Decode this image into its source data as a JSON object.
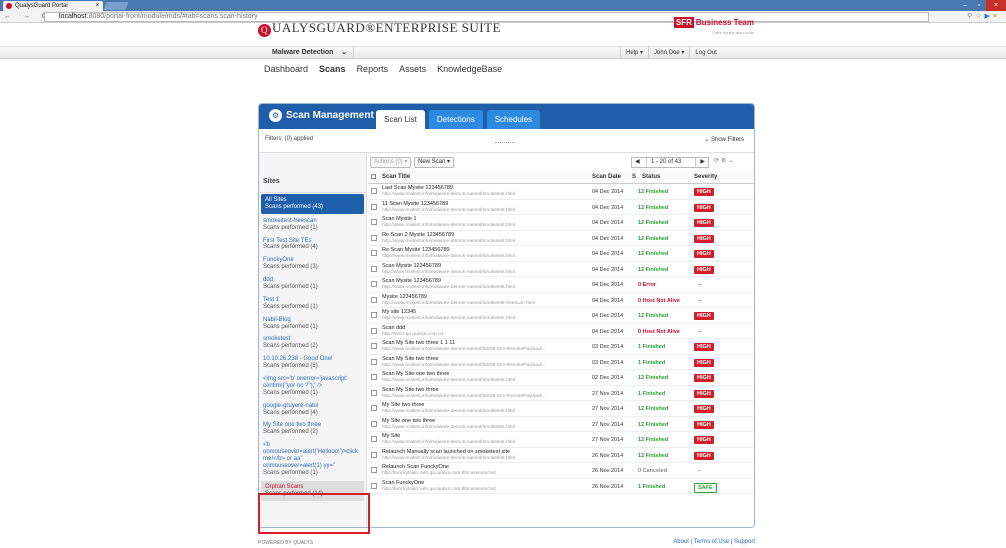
{
  "browser": {
    "tab_title": "QualysGuard Portal",
    "tab_close": "×",
    "url_host": "localhost",
    "url_rest": ":8080/portal-front/module/mds/#tab=scans.scan-history",
    "nav": "← → C"
  },
  "brand": {
    "logo_q": "Q",
    "logo_rest": "UALYSGUARD®ENTERPRISE SUITE",
    "partner_badge": "SFR",
    "partner_name": "Business Team",
    "partner_sub": "Faire équipe avec vous"
  },
  "menubar": {
    "module": "Malware Detection",
    "help": "Help ▾",
    "user": "John Doe ▾",
    "logout": "Log Out"
  },
  "topnav": [
    "Dashboard",
    "Scans",
    "Reports",
    "Assets",
    "KnowledgeBase"
  ],
  "panel": {
    "title": "Scan Management",
    "tabs": [
      "Scan List",
      "Detections",
      "Schedules"
    ],
    "filters_label": "Filters: (0) applied",
    "show_filters": "Show Filters"
  },
  "sidebar": {
    "title": "Sites",
    "sites": [
      {
        "name": "All Sites",
        "count": "Scans performed (43)",
        "state": "selected"
      },
      {
        "name": "smokeitest-freescan",
        "count": "Scans performed (1)"
      },
      {
        "name": "First Test Site TEs",
        "count": "Scans performed (4)"
      },
      {
        "name": "FunckyOne",
        "count": "Scans performed (3)"
      },
      {
        "name": "ddd",
        "count": "Scans performed (1)"
      },
      {
        "name": "Test 1",
        "count": "Scans performed (1)"
      },
      {
        "name": "Nabil-Blog",
        "count": "Scans performed (1)"
      },
      {
        "name": "smoketest",
        "count": "Scans performed (2)"
      },
      {
        "name": "10.10.26.238 - Good One!",
        "count": "Scans performed (8)"
      },
      {
        "name": "<img src='b' onerror='javascript: confirm(\"yor no ?\");' />",
        "count": "Scans performed (1)"
      },
      {
        "name": "google-gruyere-nabil",
        "count": "Scans performed (4)"
      },
      {
        "name": "My Site one two three",
        "count": "Scans performed (2)"
      },
      {
        "name": "<b onmouseover=alert('Hellooo!')>click me!</b> or aa\" onmouseover=alert(1) yy=\"",
        "count": "Scans performed (1)"
      },
      {
        "name": "Orphan Scans",
        "count": "Scans performed (14)",
        "state": "orphan"
      }
    ]
  },
  "toolbar": {
    "actions": "Actions (0) ▾",
    "new_scan": "New Scan ▾",
    "pager": "1 - 20 of 43"
  },
  "columns": {
    "title": "Scan Title",
    "date": "Scan Date",
    "s": "S",
    "status": "Status",
    "severity": "Severity"
  },
  "rows": [
    {
      "t": "Last Scan Mysite 123456789",
      "u": "http://www.mvitest.info/malware-demos-named/smoketest.html",
      "d": "04 Dec 2014",
      "n": "12",
      "s": "Finished",
      "v": "HIGH"
    },
    {
      "t": "11 Scan Mysite 123456789",
      "u": "http://www.mvitest.info/malware-demos-named/smoketest.html",
      "d": "04 Dec 2014",
      "n": "12",
      "s": "Finished",
      "v": "HIGH"
    },
    {
      "t": "Scan Mysite 1",
      "u": "http://www.mvitest.info/malware-demos-named/smoketest.html",
      "d": "04 Dec 2014",
      "n": "12",
      "s": "Finished",
      "v": "HIGH"
    },
    {
      "t": "Re Scan 2 Mysite 123456789",
      "u": "http://www.mvitest.info/malware-demos-named/smoketest.html",
      "d": "04 Dec 2014",
      "n": "12",
      "s": "Finished",
      "v": "HIGH"
    },
    {
      "t": "Re Scan Mysite 123456789",
      "u": "http://www.mvitest.info/malware-demos-named/smoketest.html",
      "d": "04 Dec 2014",
      "n": "12",
      "s": "Finished",
      "v": "HIGH"
    },
    {
      "t": "Scan Mysite 123456789",
      "u": "http://www.mvitest.info/malware-demos-named/smoketest.html",
      "d": "04 Dec 2014",
      "n": "12",
      "s": "Finished",
      "v": "HIGH"
    },
    {
      "t": "Scan Mysite 123456789",
      "u": "http://www.mvitest.info/malware-demos-named/smoketest.html",
      "d": "04 Dec 2014",
      "n": "0",
      "s": "Error",
      "v": "–"
    },
    {
      "t": "Mysite 123456789",
      "u": "http://www.mvitest.info/malware-demos-named/smoketest-freescan.html",
      "d": "04 Dec 2014",
      "n": "0",
      "s": "Host Not Alive",
      "v": "–"
    },
    {
      "t": "My site 12345",
      "u": "http://www.mvitest.info/malware-demos-named/smoketest.html",
      "d": "04 Dec 2014",
      "n": "12",
      "s": "Finished",
      "v": "HIGH"
    },
    {
      "t": "Scan ddd",
      "u": "http://test1.qa.qualys.com.cd",
      "d": "04 Dec 2014",
      "n": "0",
      "s": "Host Not Alive",
      "v": "–"
    },
    {
      "t": "Scan My Site two three 1 1 11",
      "u": "http://www.mvitest.info/malware-demos-named/MS06-014-RemotePayload/...",
      "d": "03 Dec 2014",
      "n": "1",
      "s": "Finished",
      "v": "HIGH"
    },
    {
      "t": "Scan My Site two three",
      "u": "http://www.mvitest.info/malware-demos-named/MS06-014-RemotePayload/...",
      "d": "03 Dec 2014",
      "n": "1",
      "s": "Finished",
      "v": "HIGH"
    },
    {
      "t": "Scan My Site one two three",
      "u": "http://www.mvitest.info/malware-demos-named/smoketest.html",
      "d": "02 Dec 2014",
      "n": "12",
      "s": "Finished",
      "v": "HIGH"
    },
    {
      "t": "Scan My Site two three",
      "u": "http://www.mvitest.info/malware-demos-named/MS06-014-RemotePayload/...",
      "d": "27 Nov 2014",
      "n": "1",
      "s": "Finished",
      "v": "HIGH"
    },
    {
      "t": "My Site two three",
      "u": "http://www.mvitest.info/malware-demos-named/smoketest.html",
      "d": "27 Nov 2014",
      "n": "12",
      "s": "Finished",
      "v": "HIGH"
    },
    {
      "t": "My Site one two three",
      "u": "http://www.mvitest.info/malware-demos-named/smoketest.html",
      "d": "27 Nov 2014",
      "n": "12",
      "s": "Finished",
      "v": "HIGH"
    },
    {
      "t": "My Site",
      "u": "http://www.mvitest.info/malware-demos-named/smoketest.html",
      "d": "27 Nov 2014",
      "n": "12",
      "s": "Finished",
      "v": "HIGH"
    },
    {
      "t": "Relaunch Manually scan launched on smoketest site",
      "u": "http://www.mvitest.info/malware-demos-named/smoketest.html",
      "d": "26 Nov 2014",
      "n": "12",
      "s": "Finished",
      "v": "HIGH"
    },
    {
      "t": "Relaunch Scan FunckyOne",
      "u": "http://funckytown.vuln.qa.qualys.com:80/cassium/css/",
      "d": "26 Nov 2014",
      "n": "0",
      "s": "Canceled",
      "v": "–"
    },
    {
      "t": "Scan FunckyOne",
      "u": "http://funckytown.vuln.qa.qualys.com:80/cassium/css/",
      "d": "26 Nov 2014",
      "n": "1",
      "s": "Finished",
      "v": "SAFE"
    }
  ],
  "footer": {
    "powered": "POWERED BY QUALYS",
    "links": "About | Terms of Use | Support"
  }
}
